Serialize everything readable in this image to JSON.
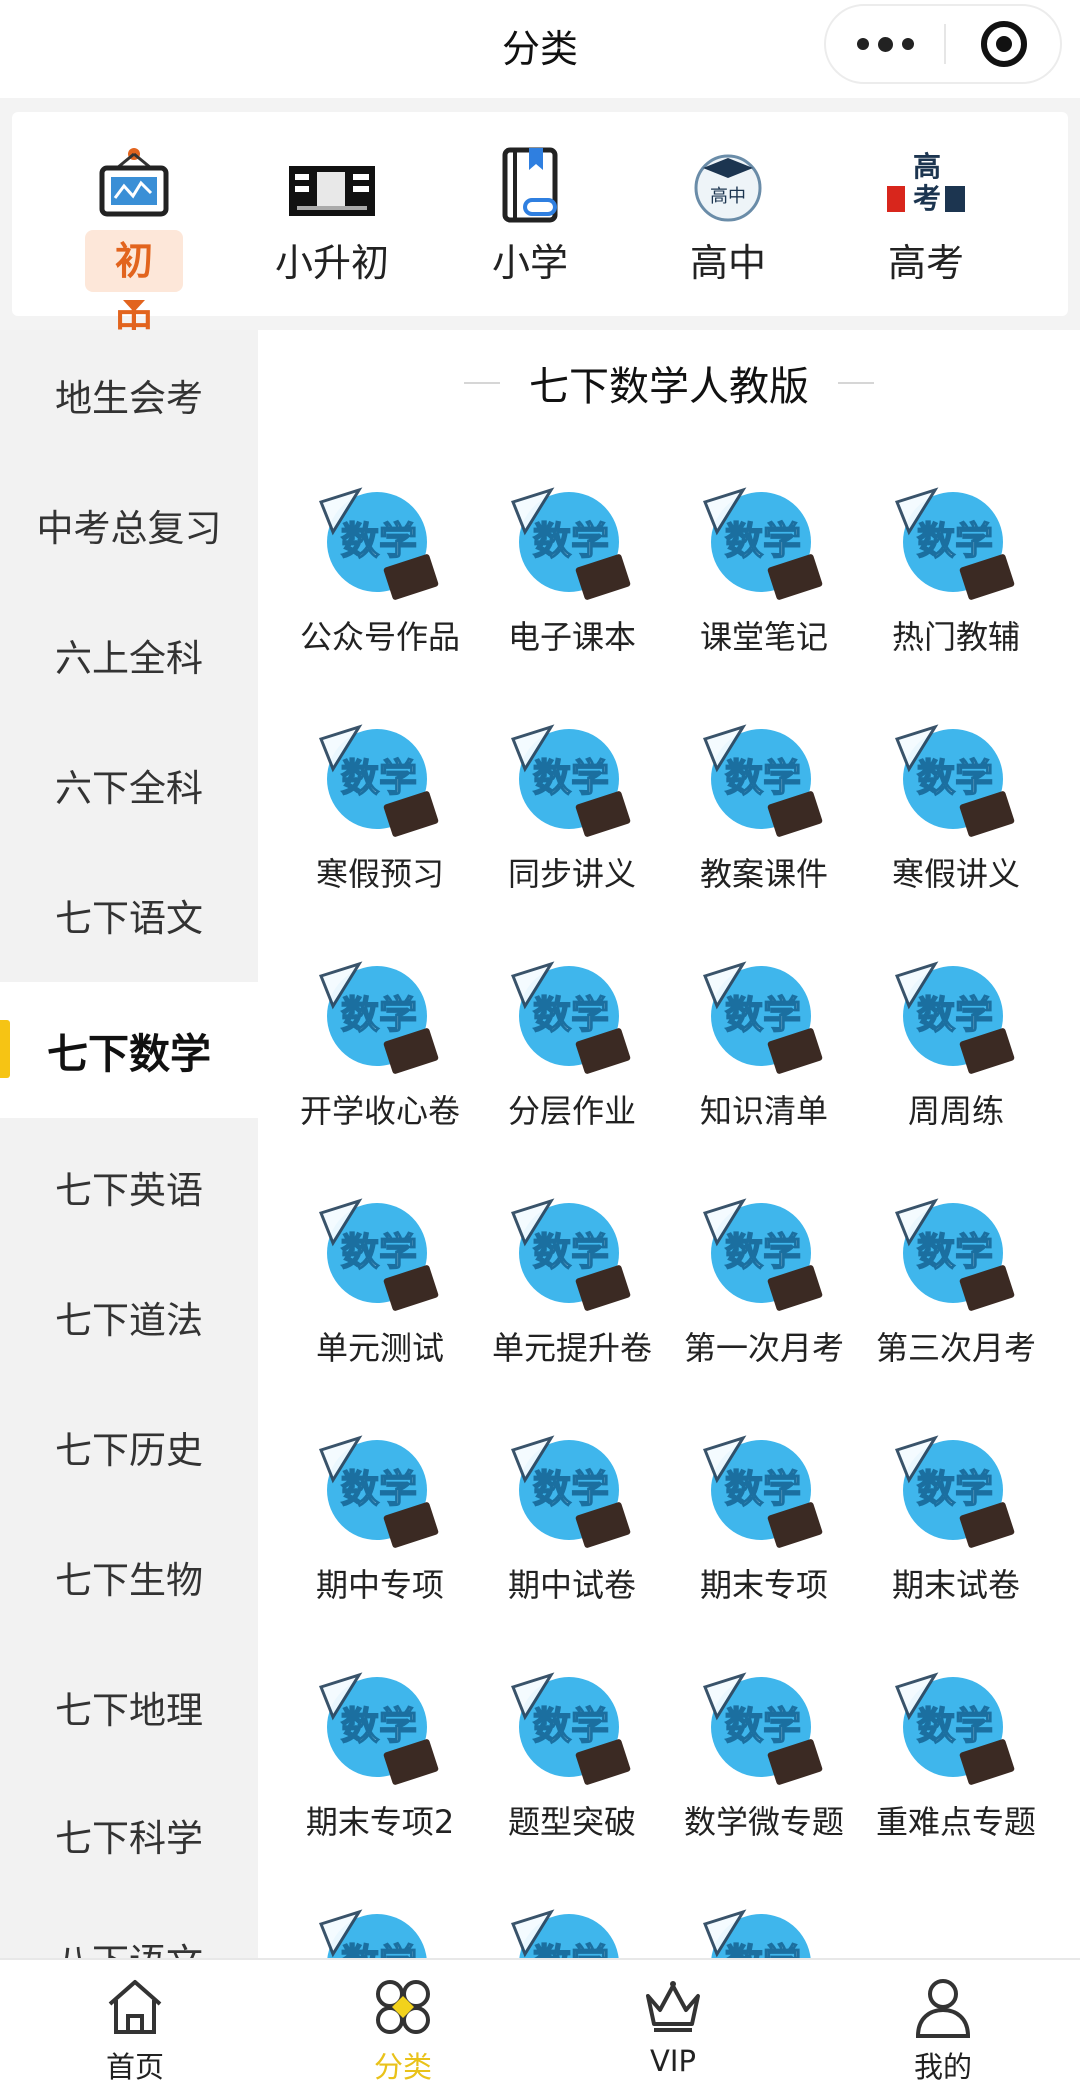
{
  "header": {
    "title": "分类"
  },
  "levels": [
    {
      "label": "初中",
      "icon": "board-icon",
      "active": true
    },
    {
      "label": "小升初",
      "icon": "banner-image-icon",
      "active": false
    },
    {
      "label": "小学",
      "icon": "book-icon",
      "active": false
    },
    {
      "label": "高中",
      "icon": "graduation-cap-icon",
      "active": false
    },
    {
      "label": "高考",
      "icon": "gaokao-logo-icon",
      "active": false
    }
  ],
  "sidebar": {
    "items": [
      {
        "label": "地生会考"
      },
      {
        "label": "中考总复习"
      },
      {
        "label": "六上全科"
      },
      {
        "label": "六下全科"
      },
      {
        "label": "七下语文"
      },
      {
        "label": "七下数学",
        "active": true
      },
      {
        "label": "七下英语"
      },
      {
        "label": "七下道法"
      },
      {
        "label": "七下历史"
      },
      {
        "label": "七下生物"
      },
      {
        "label": "七下地理"
      },
      {
        "label": "七下科学"
      },
      {
        "label": "八下语文"
      }
    ]
  },
  "content": {
    "title": "七下数学人教版",
    "icon_text": "数学",
    "items": [
      {
        "label": "公众号作品"
      },
      {
        "label": "电子课本"
      },
      {
        "label": "课堂笔记"
      },
      {
        "label": "热门教辅"
      },
      {
        "label": "寒假预习"
      },
      {
        "label": "同步讲义"
      },
      {
        "label": "教案课件"
      },
      {
        "label": "寒假讲义"
      },
      {
        "label": "开学收心卷"
      },
      {
        "label": "分层作业"
      },
      {
        "label": "知识清单"
      },
      {
        "label": "周周练"
      },
      {
        "label": "单元测试"
      },
      {
        "label": "单元提升卷"
      },
      {
        "label": "第一次月考"
      },
      {
        "label": "第三次月考"
      },
      {
        "label": "期中专项"
      },
      {
        "label": "期中试卷"
      },
      {
        "label": "期末专项"
      },
      {
        "label": "期末试卷"
      },
      {
        "label": "期末专项2"
      },
      {
        "label": "题型突破"
      },
      {
        "label": "数学微专题"
      },
      {
        "label": "重难点专题"
      },
      {
        "label": ""
      },
      {
        "label": ""
      },
      {
        "label": ""
      }
    ]
  },
  "bottom_nav": [
    {
      "label": "首页",
      "icon": "home-icon"
    },
    {
      "label": "分类",
      "icon": "category-icon",
      "active": true
    },
    {
      "label": "VIP",
      "icon": "crown-icon"
    },
    {
      "label": "我的",
      "icon": "profile-icon"
    }
  ],
  "colors": {
    "accent_orange": "#e2641e",
    "accent_yellow": "#e9c21a",
    "math_icon_blue": "#3fb6ec"
  }
}
